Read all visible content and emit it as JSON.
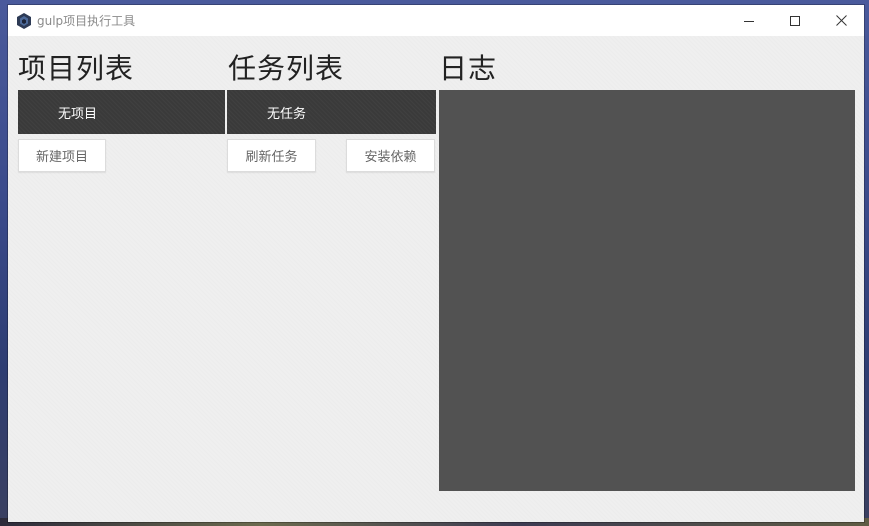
{
  "window": {
    "title": "gulp项目执行工具",
    "controls": {
      "minimize_icon": "minimize-icon",
      "maximize_icon": "maximize-icon",
      "close_icon": "close-icon"
    }
  },
  "projects": {
    "heading": "项目列表",
    "empty_text": "无项目",
    "new_button": "新建项目"
  },
  "tasks": {
    "heading": "任务列表",
    "empty_text": "无任务",
    "refresh_button": "刷新任务",
    "install_button": "安装依赖"
  },
  "log": {
    "heading": "日志",
    "content": ""
  },
  "colors": {
    "dark_bar": "#3a3a3a",
    "log_bg": "#525252",
    "window_bg": "#efefef"
  }
}
